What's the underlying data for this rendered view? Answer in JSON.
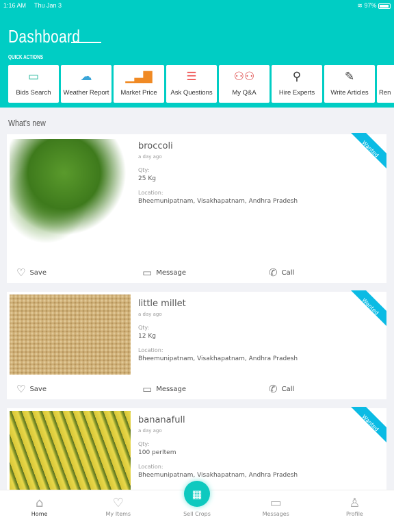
{
  "status": {
    "time": "1:16 AM",
    "date": "Thu Jan 3",
    "battery": "97%"
  },
  "header": {
    "title": "Dashboard",
    "quick_actions_label": "QUICK ACTIONS"
  },
  "quick_actions": [
    {
      "label": "Bids Search",
      "icon": "sale-sign-icon"
    },
    {
      "label": "Weather Report",
      "icon": "weather-icon"
    },
    {
      "label": "Market Price",
      "icon": "bar-chart-icon"
    },
    {
      "label": "Ask Questions",
      "icon": "question-list-icon"
    },
    {
      "label": "My Q&A",
      "icon": "qa-people-icon"
    },
    {
      "label": "Hire Experts",
      "icon": "magnifier-person-icon"
    },
    {
      "label": "Write Articles",
      "icon": "pen-document-icon"
    },
    {
      "label": "Ren",
      "icon": ""
    }
  ],
  "section_title": "What's new",
  "items": [
    {
      "name": "broccoli",
      "ago": "a day ago",
      "qty_label": "Qty:",
      "qty": "25 Kg",
      "location_label": "Location:",
      "location": "Bheemunipatnam, Visakhapatnam, Andhra Pradesh",
      "badge": "Wanted",
      "save": "Save",
      "message": "Message",
      "call": "Call"
    },
    {
      "name": "little millet",
      "ago": "a day ago",
      "qty_label": "Qty:",
      "qty": "12 Kg",
      "location_label": "Location:",
      "location": "Bheemunipatnam, Visakhapatnam, Andhra Pradesh",
      "badge": "Wanted",
      "save": "Save",
      "message": "Message",
      "call": "Call"
    },
    {
      "name": "bananafull",
      "ago": "a day ago",
      "qty_label": "Qty:",
      "qty": "100 perItem",
      "location_label": "Location:",
      "location": "Bheemunipatnam, Visakhapatnam, Andhra Pradesh",
      "badge": "Wanted"
    }
  ],
  "nav": [
    {
      "label": "Home"
    },
    {
      "label": "My Items"
    },
    {
      "label": "Sell Crops"
    },
    {
      "label": "Messages"
    },
    {
      "label": "Profile"
    }
  ],
  "colors": {
    "accent": "#00cdc4",
    "ribbon": "#0bbbe4"
  }
}
